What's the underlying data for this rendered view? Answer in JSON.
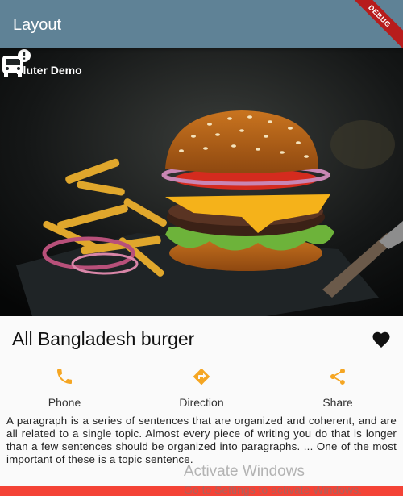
{
  "app_bar": {
    "title": "Layout",
    "debug_banner": "DEBUG"
  },
  "hero": {
    "caption": "Fluter Demo",
    "badge_icon": "bus-alert-icon"
  },
  "product": {
    "title": "All Bangladesh burger",
    "favorite_icon": "heart-icon"
  },
  "actions": [
    {
      "label": "Phone",
      "icon": "phone-icon"
    },
    {
      "label": "Direction",
      "icon": "direction-icon"
    },
    {
      "label": "Share",
      "icon": "share-icon"
    }
  ],
  "description": "A paragraph is a series of sentences that are organized and coherent, and are all related to a single topic. Almost every piece of writing you do that is longer than a few sentences should be organized into paragraphs. ... One of the most important of these is a topic sentence.",
  "overlay": {
    "line1": "Activate Windows",
    "line2": "Go to Settings to activate Windows."
  },
  "colors": {
    "app_bar": "#5f8296",
    "accent": "#f5a623",
    "bottom_bar": "#f44336",
    "debug": "#b71c1c"
  }
}
